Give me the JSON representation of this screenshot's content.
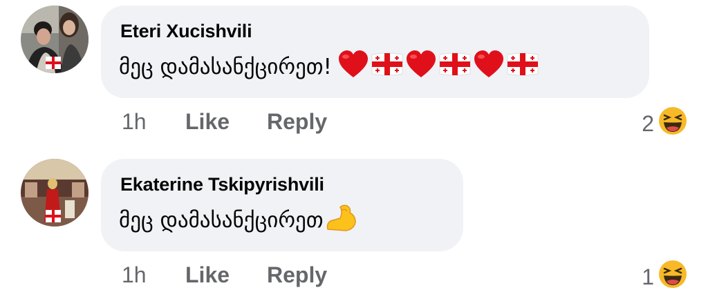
{
  "comments": [
    {
      "author": "Eteri Xucishvili",
      "text": "მეც დამასანქცირეთ!",
      "emojis": [
        "heart",
        "georgia-flag",
        "heart",
        "georgia-flag",
        "heart",
        "georgia-flag"
      ],
      "time": "1h",
      "like_label": "Like",
      "reply_label": "Reply",
      "reaction_count": "2",
      "reaction_icon": "laughing-face-icon"
    },
    {
      "author": "Ekaterine Tskipyrishvili",
      "text": "მეც დამასანქცირეთ",
      "emojis": [
        "flexed-biceps"
      ],
      "time": "1h",
      "like_label": "Like",
      "reply_label": "Reply",
      "reaction_count": "1",
      "reaction_icon": "laughing-face-icon"
    }
  ],
  "colors": {
    "bubble": "#f0f2f5",
    "secondary_text": "#65676b",
    "primary_text": "#050505",
    "heart": "#e0101a"
  }
}
